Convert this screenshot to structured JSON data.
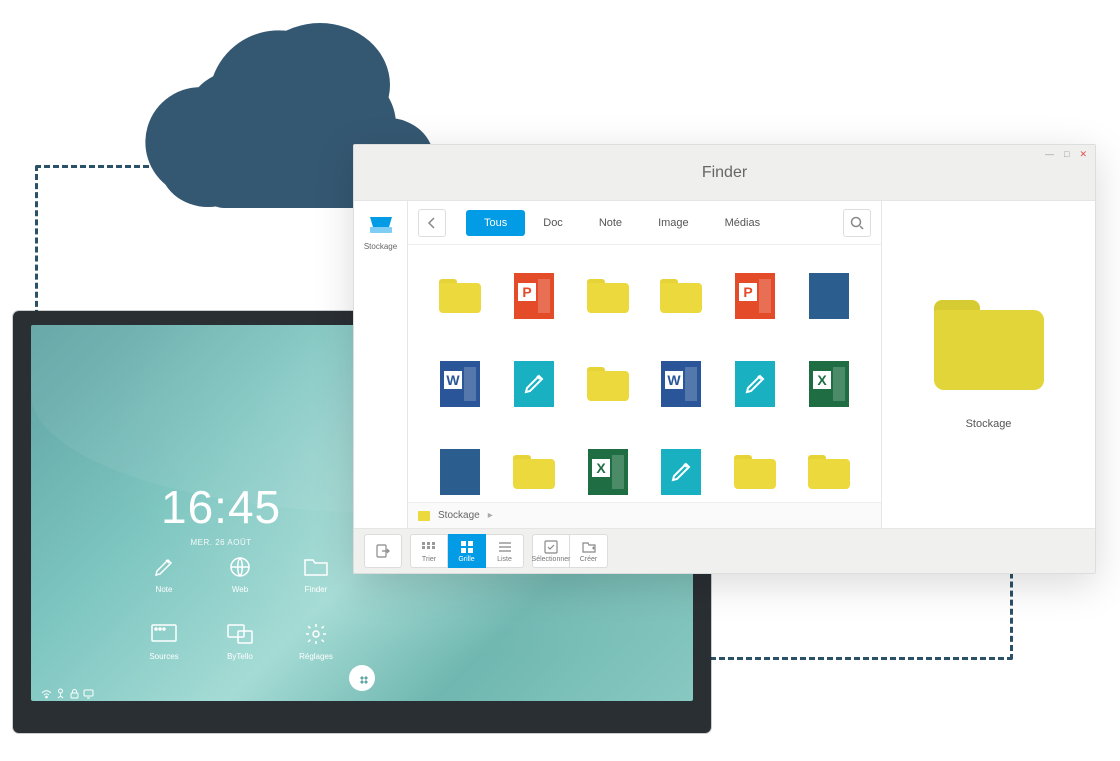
{
  "monitor": {
    "time": "16:45",
    "date": "MER. 26 AOÛT",
    "apps": {
      "note": "Note",
      "web": "Web",
      "finder": "Finder",
      "sources": "Sources",
      "bytello": "ByTello",
      "settings": "Réglages"
    }
  },
  "finder": {
    "title": "Finder",
    "sidebar": {
      "storage": "Stockage"
    },
    "tabs": {
      "all": "Tous",
      "doc": "Doc",
      "note": "Note",
      "image": "Image",
      "media": "Médias"
    },
    "files": [
      {
        "type": "folder"
      },
      {
        "type": "ppt",
        "label": "P"
      },
      {
        "type": "folder"
      },
      {
        "type": "folder"
      },
      {
        "type": "ppt",
        "label": "P"
      },
      {
        "type": "lines"
      },
      {
        "type": "word",
        "label": "W"
      },
      {
        "type": "note"
      },
      {
        "type": "folder"
      },
      {
        "type": "word",
        "label": "W"
      },
      {
        "type": "note"
      },
      {
        "type": "excel",
        "label": "X"
      },
      {
        "type": "lines"
      },
      {
        "type": "folder"
      },
      {
        "type": "excel",
        "label": "X"
      },
      {
        "type": "note"
      },
      {
        "type": "folder"
      },
      {
        "type": "folder"
      }
    ],
    "breadcrumb": {
      "root": "Stockage"
    },
    "preview": {
      "label": "Stockage"
    },
    "bottom": {
      "sort": "Trier",
      "grid": "Grille",
      "list": "Liste",
      "select": "Sélectionner",
      "create": "Créer"
    }
  },
  "colors": {
    "cloud": "#355872",
    "accent": "#029be5",
    "dashed": "#2b5168"
  }
}
